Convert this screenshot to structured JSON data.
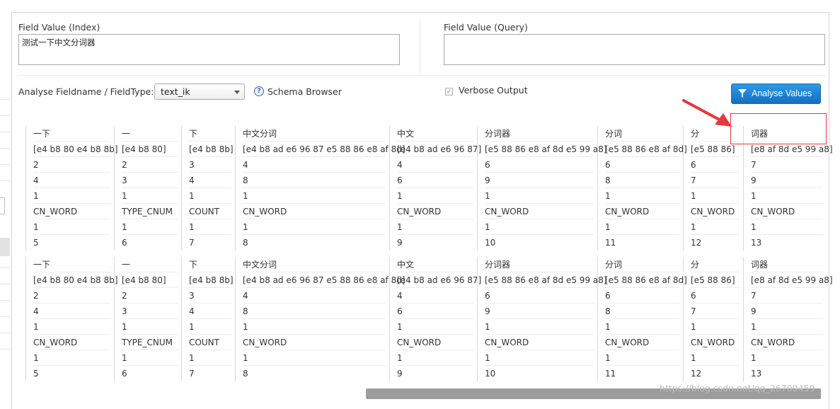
{
  "index_field": {
    "label": "Field Value (Index)",
    "value": "测试一下中文分词器"
  },
  "query_field": {
    "label": "Field Value (Query)",
    "value": ""
  },
  "analyse": {
    "fieldname_label": "Analyse Fieldname / FieldType:",
    "fieldtype_selected": "text_ik",
    "schema_browser_label": "Schema Browser",
    "help_icon": "?",
    "verbose_label": "Verbose Output",
    "verbose_checked": true,
    "analyse_button_label": "Analyse Values",
    "accent_color": "#1170c4"
  },
  "tokens": [
    {
      "rows": [
        "一下",
        "[e4 b8 80 e4 b8 8b]",
        "2",
        "4",
        "1",
        "CN_WORD",
        "1",
        "5"
      ]
    },
    {
      "rows": [
        "一",
        "[e4 b8 80]",
        "2",
        "3",
        "1",
        "TYPE_CNUM",
        "1",
        "6"
      ]
    },
    {
      "rows": [
        "下",
        "[e4 b8 8b]",
        "3",
        "4",
        "1",
        "COUNT",
        "1",
        "7"
      ]
    },
    {
      "rows": [
        "中文分词",
        "[e4 b8 ad e6 96 87 e5 88 86 e8 af 8d]",
        "4",
        "8",
        "1",
        "CN_WORD",
        "1",
        "8"
      ]
    },
    {
      "rows": [
        "中文",
        "[e4 b8 ad e6 96 87]",
        "4",
        "6",
        "1",
        "CN_WORD",
        "1",
        "9"
      ]
    },
    {
      "rows": [
        "分词器",
        "[e5 88 86 e8 af 8d e5 99 a8]",
        "6",
        "9",
        "1",
        "CN_WORD",
        "1",
        "10"
      ]
    },
    {
      "rows": [
        "分词",
        "[e5 88 86 e8 af 8d]",
        "6",
        "8",
        "1",
        "CN_WORD",
        "1",
        "11"
      ]
    },
    {
      "rows": [
        "分",
        "[e5 88 86]",
        "6",
        "7",
        "1",
        "CN_WORD",
        "1",
        "12"
      ]
    },
    {
      "rows": [
        "词器",
        "[e8 af 8d e5 99 a8]",
        "7",
        "9",
        "1",
        "CN_WORD",
        "1",
        "13"
      ]
    }
  ],
  "watermark": "https://blog.csdn.net/qq_26709459",
  "highlight_color": "#e4393c"
}
